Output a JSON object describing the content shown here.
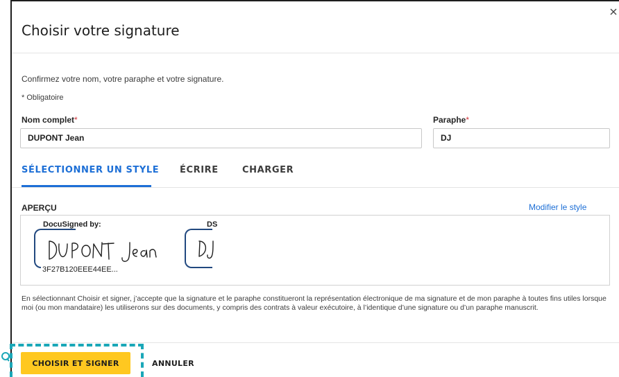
{
  "dialog": {
    "title": "Choisir votre signature",
    "close_icon": "close-icon"
  },
  "form": {
    "intro": "Confirmez votre nom, votre paraphe et votre signature.",
    "required_note": "* Obligatoire",
    "full_name": {
      "label": "Nom complet",
      "required_mark": "*",
      "value": "DUPONT Jean"
    },
    "initials": {
      "label": "Paraphe",
      "required_mark": "*",
      "value": "DJ"
    }
  },
  "tabs": [
    {
      "label": "SÉLECTIONNER UN STYLE",
      "active": true
    },
    {
      "label": "ÉCRIRE",
      "active": false
    },
    {
      "label": "CHARGER",
      "active": false
    }
  ],
  "preview": {
    "label": "APERÇU",
    "change_style_link": "Modifier le style",
    "signature": {
      "header": "DocuSigned by:",
      "handwriting": "DUPONT Jean",
      "hash": "3F27B120EEE44EE..."
    },
    "initials": {
      "header": "DS",
      "handwriting": "DJ"
    }
  },
  "consent_text": "En sélectionnant Choisir et signer, j’accepte que la signature et le paraphe constitueront la représentation électronique de ma signature et de mon paraphe à toutes fins utiles lorsque moi (ou mon mandataire) les utiliserons sur des documents, y compris des contrats à valeur exécutoire, à l’identique d’une signature ou d’un paraphe manuscrit.",
  "footer": {
    "primary_button": "CHOISIR ET SIGNER",
    "secondary_button": "ANNULER"
  },
  "colors": {
    "accent": "#1d6fd6",
    "primary_button": "#ffc820",
    "required": "#d13239",
    "signature_frame": "#21487f",
    "focus_ring": "#1aa7b8"
  }
}
